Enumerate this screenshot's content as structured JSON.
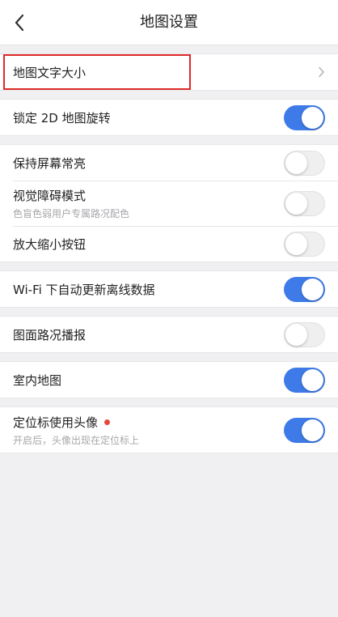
{
  "header": {
    "title": "地图设置",
    "back_icon": "chevron-left-icon"
  },
  "groups": [
    {
      "rows": [
        {
          "id": "font-size",
          "label": "地图文字大小",
          "control": "chevron",
          "highlighted": true
        }
      ]
    },
    {
      "rows": [
        {
          "id": "lock-2d",
          "label": "锁定 2D 地图旋转",
          "control": "toggle",
          "on": true
        }
      ]
    },
    {
      "rows": [
        {
          "id": "keep-screen-on",
          "label": "保持屏幕常亮",
          "control": "toggle",
          "on": false
        },
        {
          "id": "visual-impairment",
          "label": "视觉障碍模式",
          "sub": "色盲色弱用户专属路况配色",
          "control": "toggle",
          "on": false
        },
        {
          "id": "zoom-buttons",
          "label": "放大缩小按钮",
          "control": "toggle",
          "on": false
        }
      ]
    },
    {
      "rows": [
        {
          "id": "wifi-offline",
          "label": "Wi-Fi 下自动更新离线数据",
          "control": "toggle",
          "on": true
        }
      ]
    },
    {
      "rows": [
        {
          "id": "traffic-broadcast",
          "label": "图面路况播报",
          "control": "toggle",
          "on": false
        }
      ]
    },
    {
      "rows": [
        {
          "id": "indoor-map",
          "label": "室内地图",
          "control": "toggle",
          "on": true
        }
      ]
    },
    {
      "rows": [
        {
          "id": "avatar-marker",
          "label": "定位标使用头像",
          "sub": "开启后，头像出现在定位标上",
          "control": "toggle",
          "on": true,
          "badge_dot": true
        }
      ]
    }
  ],
  "colors": {
    "toggle_on": "#3e7be8",
    "highlight_border": "#e02a2a",
    "badge_dot": "#e8483a"
  }
}
